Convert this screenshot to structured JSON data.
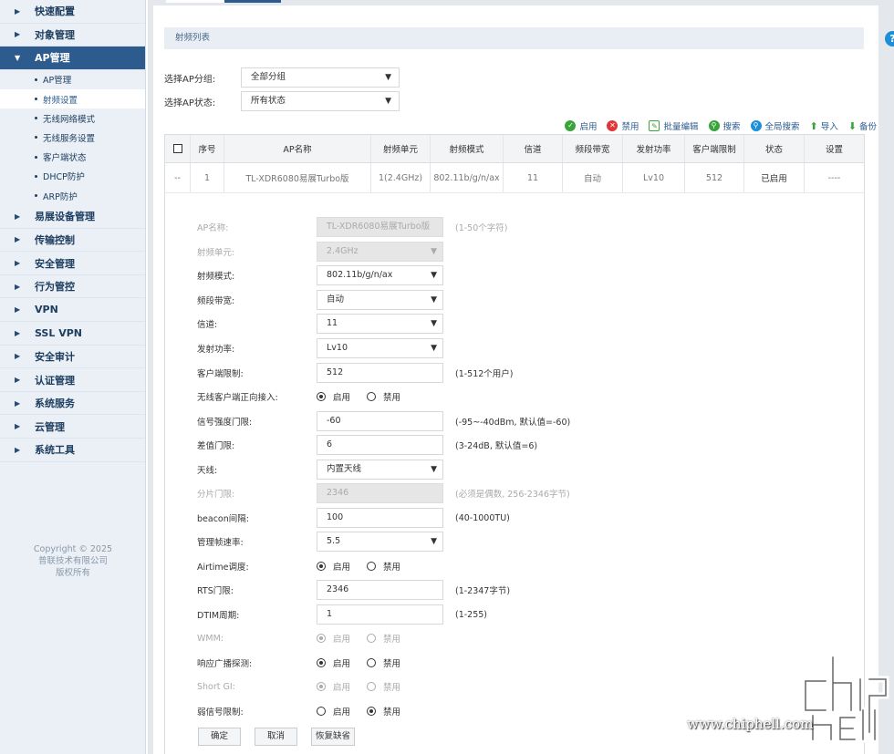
{
  "sidebar": {
    "items": [
      {
        "label": "快速配置"
      },
      {
        "label": "对象管理"
      },
      {
        "label": "AP管理",
        "expanded": true
      },
      {
        "label": "易展设备管理"
      },
      {
        "label": "传输控制"
      },
      {
        "label": "安全管理"
      },
      {
        "label": "行为管控"
      },
      {
        "label": "VPN"
      },
      {
        "label": "SSL VPN"
      },
      {
        "label": "安全审计"
      },
      {
        "label": "认证管理"
      },
      {
        "label": "系统服务"
      },
      {
        "label": "云管理"
      },
      {
        "label": "系统工具"
      }
    ],
    "sub_items": [
      "AP管理",
      "射频设置",
      "无线网络模式",
      "无线服务设置",
      "客户端状态",
      "DHCP防护",
      "ARP防护"
    ],
    "selected_sub": "射频设置",
    "copyright": [
      "Copyright © 2025",
      "普联技术有限公司",
      "版权所有"
    ]
  },
  "section_title": "射频列表",
  "filters": {
    "group_label": "选择AP分组:",
    "group_value": "全部分组",
    "status_label": "选择AP状态:",
    "status_value": "所有状态"
  },
  "toolbar": {
    "enable": "启用",
    "disable": "禁用",
    "batch_edit": "批量编辑",
    "search": "搜索",
    "global_search": "全局搜索",
    "import": "导入",
    "backup": "备份"
  },
  "table": {
    "headers": [
      "序号",
      "AP名称",
      "射频单元",
      "射频模式",
      "信道",
      "频段带宽",
      "发射功率",
      "客户端限制",
      "状态",
      "设置"
    ],
    "row": {
      "check": "--",
      "index": "1",
      "ap_name": "TL-XDR6080易展Turbo版",
      "unit": "1(2.4GHz)",
      "mode": "802.11b/g/n/ax",
      "channel": "11",
      "bandwidth": "自动",
      "power": "Lv10",
      "client_limit": "512",
      "status": "已启用",
      "settings": "----"
    }
  },
  "form": {
    "ap_name": {
      "label": "AP名称:",
      "value": "TL-XDR6080易展Turbo版",
      "hint": "(1-50个字符)"
    },
    "rf_unit": {
      "label": "射频单元:",
      "value": "2.4GHz"
    },
    "rf_mode": {
      "label": "射频模式:",
      "value": "802.11b/g/n/ax"
    },
    "bandwidth": {
      "label": "频段带宽:",
      "value": "自动"
    },
    "channel": {
      "label": "信道:",
      "value": "11"
    },
    "tx_power": {
      "label": "发射功率:",
      "value": "Lv10"
    },
    "client_limit": {
      "label": "客户端限制:",
      "value": "512",
      "hint": "(1-512个用户)"
    },
    "forward_access": {
      "label": "无线客户端正向接入:",
      "on": "启用",
      "off": "禁用"
    },
    "signal_threshold": {
      "label": "信号强度门限:",
      "value": "-60",
      "hint": "(-95~-40dBm, 默认值=-60)"
    },
    "diff_threshold": {
      "label": "差值门限:",
      "value": "6",
      "hint": "(3-24dB, 默认值=6)"
    },
    "antenna": {
      "label": "天线:",
      "value": "内置天线"
    },
    "frag_threshold": {
      "label": "分片门限:",
      "value": "2346",
      "hint": "(必须是偶数, 256-2346字节)"
    },
    "beacon": {
      "label": "beacon间隔:",
      "value": "100",
      "hint": "(40-1000TU)"
    },
    "mgmt_rate": {
      "label": "管理帧速率:",
      "value": "5.5"
    },
    "airtime": {
      "label": "Airtime调度:",
      "on": "启用",
      "off": "禁用"
    },
    "rts": {
      "label": "RTS门限:",
      "value": "2346",
      "hint": "(1-2347字节)"
    },
    "dtim": {
      "label": "DTIM周期:",
      "value": "1",
      "hint": "(1-255)"
    },
    "wmm": {
      "label": "WMM:",
      "on": "启用",
      "off": "禁用"
    },
    "probe_response": {
      "label": "响应广播探测:",
      "on": "启用",
      "off": "禁用"
    },
    "short_gi": {
      "label": "Short GI:",
      "on": "启用",
      "off": "禁用"
    },
    "weak_signal": {
      "label": "弱信号限制:",
      "on": "启用",
      "off": "禁用"
    }
  },
  "buttons": {
    "ok": "确定",
    "cancel": "取消",
    "restore": "恢复缺省"
  },
  "watermark": {
    "text": "www.chiphell.com"
  }
}
